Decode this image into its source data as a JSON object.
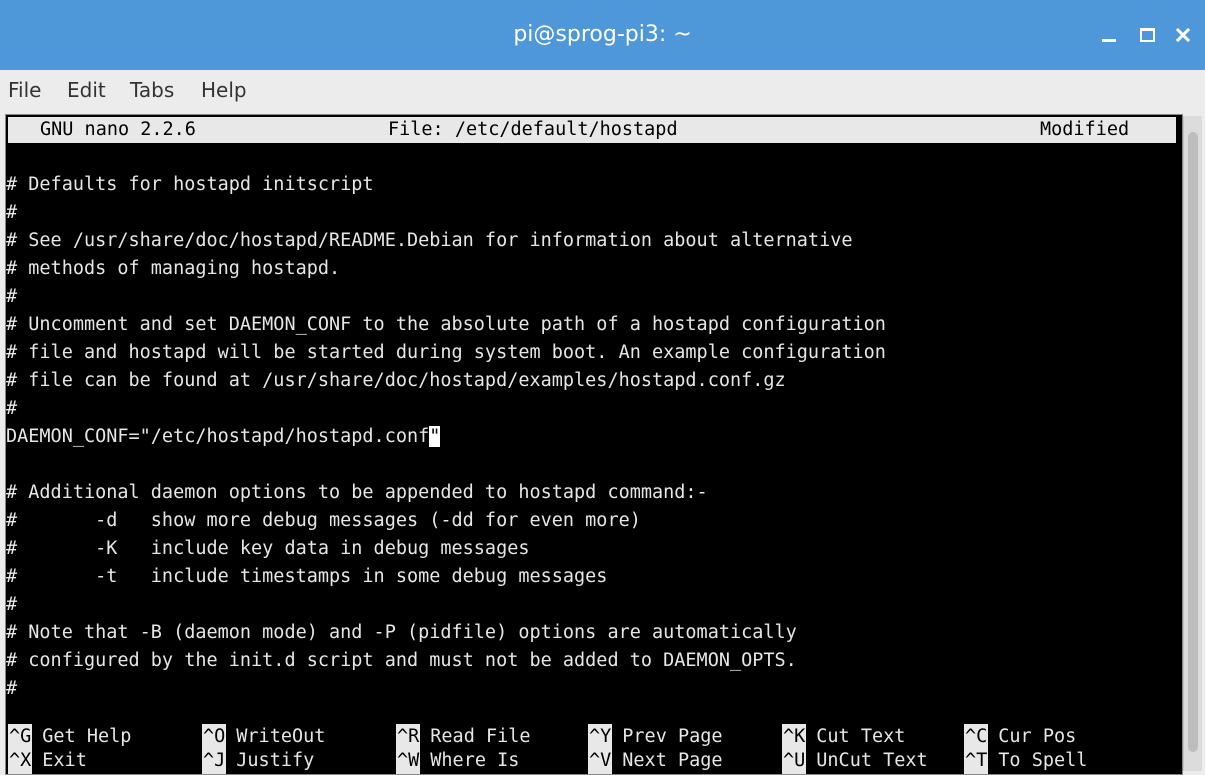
{
  "window": {
    "title": "pi@sprog-pi3: ~",
    "controls": {
      "minimize": "minimize-icon",
      "maximize": "maximize-icon",
      "close": "close-icon"
    }
  },
  "menu": [
    "File",
    "Edit",
    "Tabs",
    "Help"
  ],
  "nano": {
    "version": "GNU nano 2.2.6",
    "file": "File: /etc/default/hostapd",
    "status": "Modified"
  },
  "lines": [
    "# Defaults for hostapd initscript",
    "#",
    "# See /usr/share/doc/hostapd/README.Debian for information about alternative",
    "# methods of managing hostapd.",
    "#",
    "# Uncomment and set DAEMON_CONF to the absolute path of a hostapd configuration",
    "# file and hostapd will be started during system boot. An example configuration",
    "# file can be found at /usr/share/doc/hostapd/examples/hostapd.conf.gz",
    "#",
    "DAEMON_CONF=\"/etc/hostapd/hostapd.conf",
    "",
    "# Additional daemon options to be appended to hostapd command:-",
    "#       -d   show more debug messages (-dd for even more)",
    "#       -K   include key data in debug messages",
    "#       -t   include timestamps in some debug messages",
    "#",
    "# Note that -B (daemon mode) and -P (pidfile) options are automatically",
    "# configured by the init.d script and must not be added to DAEMON_OPTS.",
    "#"
  ],
  "cursor_char": "\"",
  "shortcuts_row1": [
    {
      "key": "^G",
      "label": "Get Help"
    },
    {
      "key": "^O",
      "label": "WriteOut"
    },
    {
      "key": "^R",
      "label": "Read File"
    },
    {
      "key": "^Y",
      "label": "Prev Page"
    },
    {
      "key": "^K",
      "label": "Cut Text"
    },
    {
      "key": "^C",
      "label": "Cur Pos"
    }
  ],
  "shortcuts_row2": [
    {
      "key": "^X",
      "label": "Exit"
    },
    {
      "key": "^J",
      "label": "Justify"
    },
    {
      "key": "^W",
      "label": "Where Is"
    },
    {
      "key": "^V",
      "label": "Next Page"
    },
    {
      "key": "^U",
      "label": "UnCut Text"
    },
    {
      "key": "^T",
      "label": "To Spell"
    }
  ]
}
